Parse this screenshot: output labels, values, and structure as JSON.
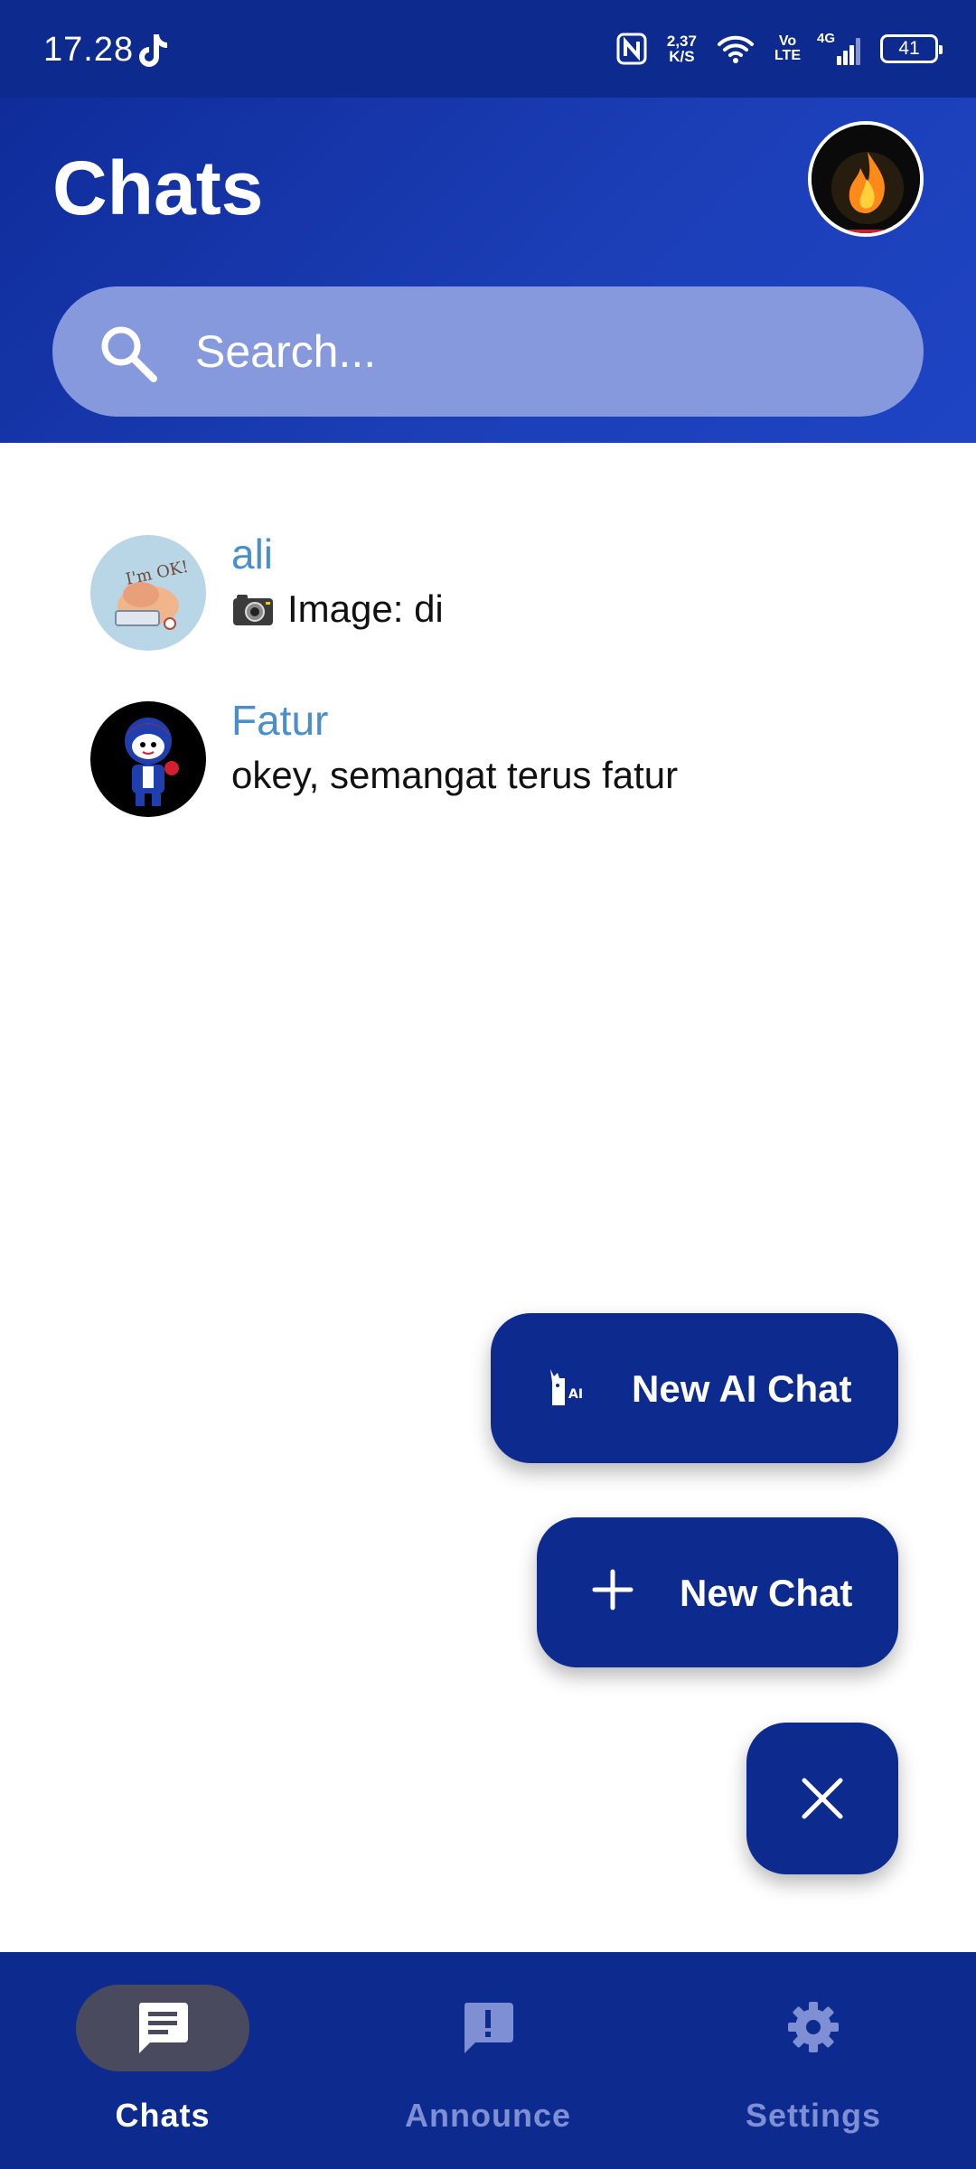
{
  "status_bar": {
    "time": "17.28",
    "net_speed_value": "2,37",
    "net_speed_unit": "K/S",
    "volte_top": "Vo",
    "volte_bottom": "LTE",
    "network": "4G",
    "battery": "41"
  },
  "header": {
    "title": "Chats",
    "search_placeholder": "Search..."
  },
  "chats": [
    {
      "name": "ali",
      "preview": "Image: di",
      "preview_icon": "camera-icon"
    },
    {
      "name": "Fatur",
      "preview": "okey, semangat terus fatur"
    }
  ],
  "fab": {
    "ai_chat_label": "New AI Chat",
    "new_chat_label": "New Chat",
    "close_icon": "close-icon"
  },
  "bottom_nav": {
    "items": [
      {
        "label": "Chats",
        "icon": "chat-icon",
        "active": true
      },
      {
        "label": "Announce",
        "icon": "announce-icon",
        "active": false
      },
      {
        "label": "Settings",
        "icon": "gear-icon",
        "active": false
      }
    ]
  },
  "colors": {
    "primary": "#0d2a8f",
    "header_gradient_end": "#1e44c4",
    "search_bg": "#8599dc",
    "chat_name": "#4a8fc9",
    "nav_inactive": "#7e8fd4"
  }
}
